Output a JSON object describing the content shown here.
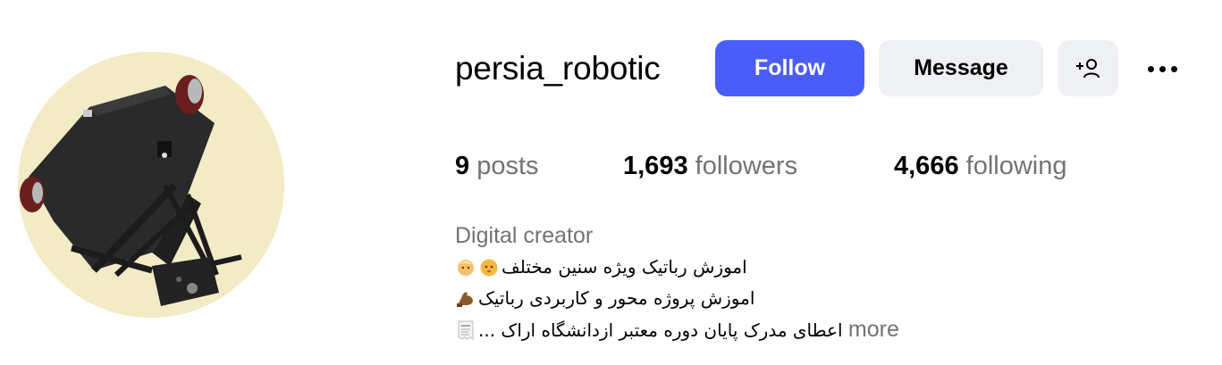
{
  "profile": {
    "username": "persia_robotic",
    "avatar_icon": "robot-photo-avatar"
  },
  "actions": {
    "follow_label": "Follow",
    "message_label": "Message",
    "add_user_icon": "add-person-icon",
    "more_icon": "more-options-icon"
  },
  "stats": {
    "posts_count": "9",
    "posts_label": "posts",
    "followers_count": "1,693",
    "followers_label": "followers",
    "following_count": "4,666",
    "following_label": "following"
  },
  "bio": {
    "category": "Digital creator",
    "line1": "اموزش رباتیک ویژه سنین مختلف",
    "line2": "اموزش پروژه محور و کاربردی رباتیک",
    "line3": "اعطای مدرک پایان دوره معتبر ازدانشگاه اراک ...",
    "more_label": "more"
  },
  "colors": {
    "follow_button": "#4a5df9",
    "secondary_button": "#eff0f3",
    "muted_text": "#737373",
    "avatar_bg": "#f3ebc6"
  }
}
